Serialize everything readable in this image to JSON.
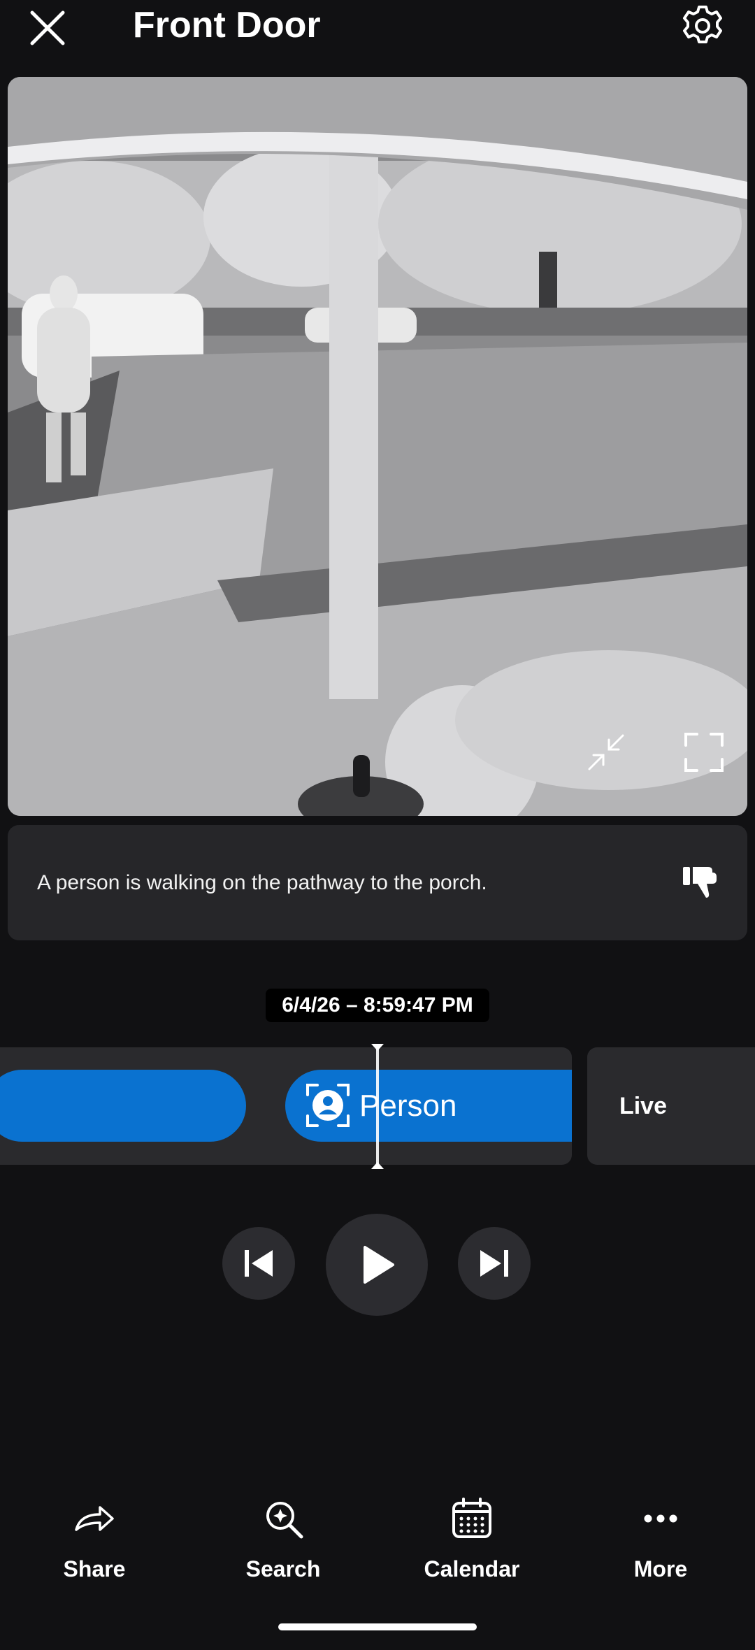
{
  "header": {
    "title": "Front Door",
    "close_icon": "close-icon",
    "settings_icon": "gear-icon"
  },
  "video": {
    "content": "Black-and-white night-vision doorbell camera view of a front porch, walkway and lawn",
    "controls": {
      "minimize_icon": "minimize-icon",
      "fullscreen_icon": "fullscreen-icon"
    }
  },
  "description": {
    "text": "A person is walking on the pathway to the porch.",
    "feedback_icon": "thumbs-down-icon"
  },
  "timeline": {
    "timestamp": "6/4/26 – 8:59:47 PM",
    "current_event": {
      "label": "Person",
      "icon": "person-icon"
    },
    "live_label": "Live"
  },
  "playback": {
    "prev_icon": "skip-previous-icon",
    "play_icon": "play-icon",
    "next_icon": "skip-next-icon"
  },
  "bottom_nav": [
    {
      "label": "Share",
      "icon": "share-icon"
    },
    {
      "label": "Search",
      "icon": "search-sparkle-icon"
    },
    {
      "label": "Calendar",
      "icon": "calendar-icon"
    },
    {
      "label": "More",
      "icon": "more-icon"
    }
  ],
  "colors": {
    "background": "#111113",
    "card": "#262629",
    "accent": "#0a72d0"
  }
}
